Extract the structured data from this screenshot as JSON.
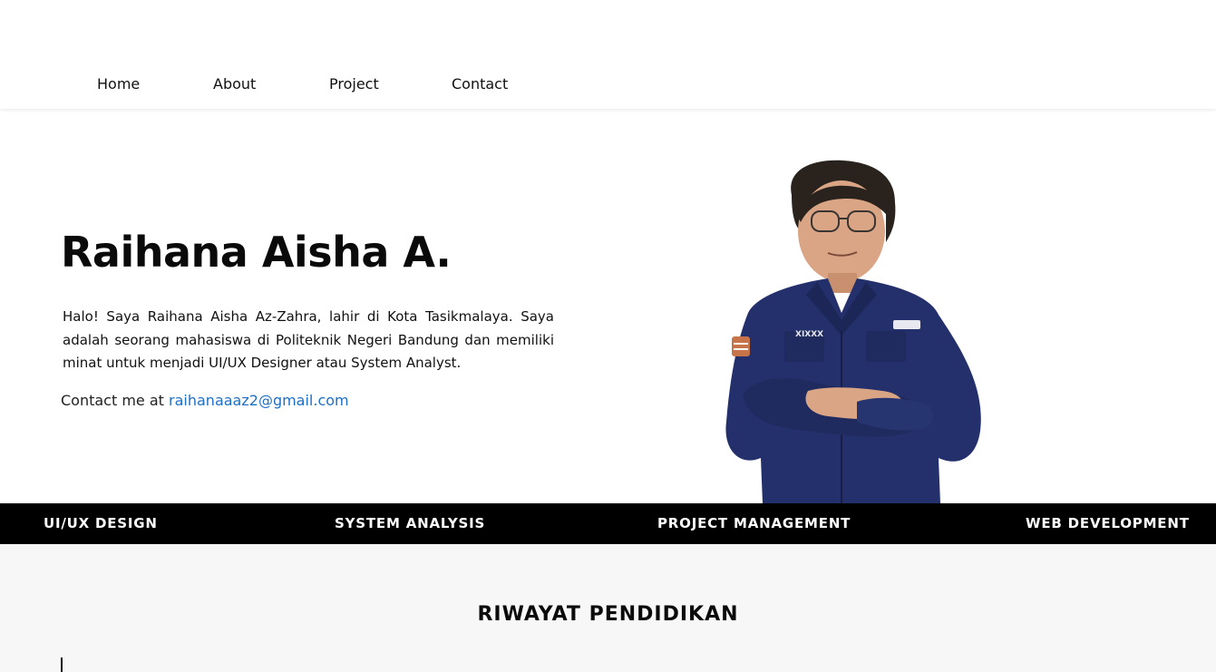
{
  "nav": {
    "items": [
      {
        "label": "Home"
      },
      {
        "label": "About"
      },
      {
        "label": "Project"
      },
      {
        "label": "Contact"
      }
    ]
  },
  "hero": {
    "name": "Raihana Aisha A.",
    "bio": "Halo! Saya Raihana Aisha Az-Zahra, lahir di Kota Tasikmalaya. Saya adalah seorang mahasiswa di Politeknik Negeri Bandung dan memiliki minat untuk menjadi UI/UX Designer atau System Analyst.",
    "contact_prefix": "Contact me at",
    "email": "raihanaaaz2@gmail.com"
  },
  "skills": [
    "UI/UX DESIGN",
    "SYSTEM ANALYSIS",
    "PROJECT MANAGEMENT",
    "WEB DEVELOPMENT"
  ],
  "education": {
    "title": "RIWAYAT PENDIDIKAN"
  },
  "colors": {
    "link": "#1f6fc4",
    "ribbon": "#000000",
    "section_bg": "#f7f7f7"
  }
}
